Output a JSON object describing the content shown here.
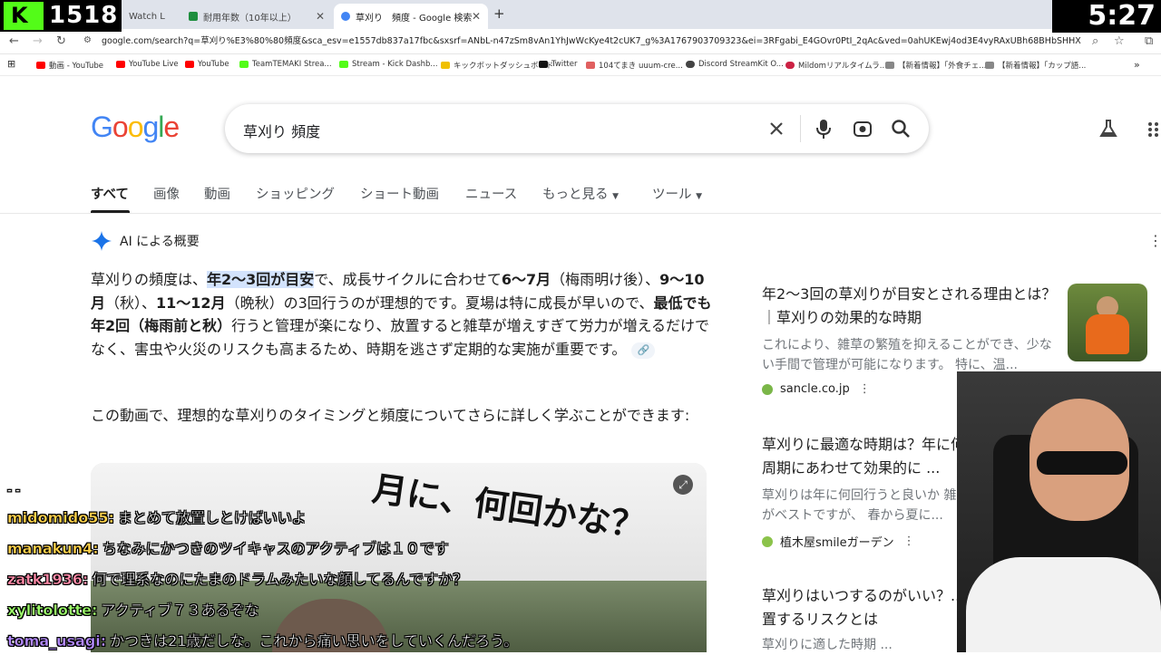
{
  "browser": {
    "tabs": [
      {
        "label": "Watch L",
        "active": false
      },
      {
        "label": "耐用年数（10年以上）",
        "active": false
      },
      {
        "label": "草刈り　頻度 - Google 検索",
        "active": true
      }
    ],
    "new_tab_label": "+",
    "url": "google.com/search?q=草刈り%E3%80%80頻度&sca_esv=e1557db837a17fbc&sxsrf=ANbL-n47zSm8vAn1YhJwWcKye4t2cUK7_g%3A1767903709323&ei=3RFgabi_E4GOvr0PtI_2qAc&ved=0ahUKEwj4od3E4vyRAxUBh68BHbSHHXUQ4dUDCBE&ua...",
    "bookmarks": [
      {
        "label": "動画 - YouTube",
        "color": "#ff0000"
      },
      {
        "label": "YouTube Live",
        "color": "#ff0000"
      },
      {
        "label": "YouTube",
        "color": "#ff0000"
      },
      {
        "label": "TeamTEMAKI Strea...",
        "color": "#53fc18"
      },
      {
        "label": "Stream - Kick Dashb...",
        "color": "#53fc18"
      },
      {
        "label": "キックボットダッシュボード",
        "color": "#f0c000"
      },
      {
        "label": "Twitter",
        "color": "#111111"
      },
      {
        "label": "104てまき uuum-cre...",
        "color": "#e06060"
      },
      {
        "label": "Discord StreamKit O...",
        "color": "#444444"
      },
      {
        "label": "Mildomリアルタイムラ...",
        "color": "#cc2244"
      },
      {
        "label": "【新着情報】「外食チェ...",
        "color": "#888888"
      },
      {
        "label": "【新着情報】「カップ語...",
        "color": "#888888"
      }
    ],
    "bookmarks_more": "»"
  },
  "stream": {
    "viewer_logo": "K",
    "viewer_count": "1518",
    "timer": "5:27"
  },
  "google": {
    "logo": "Google",
    "query": "草刈り 頻度",
    "tabs": [
      "すべて",
      "画像",
      "動画",
      "ショッピング",
      "ショート動画",
      "ニュース",
      "もっと見る",
      "ツール"
    ]
  },
  "ai_overview": {
    "heading": "AI による概要",
    "p1_a": "草刈りの頻度は、",
    "p1_b": "年2〜3回が目安",
    "p1_c": "で、成長サイクルに合わせて",
    "p1_d": "6〜7月",
    "p1_e": "（梅雨明け後）、",
    "p1_f": "9〜10月",
    "p1_g": "（秋）、",
    "p1_h": "11〜12月",
    "p1_i": "（晩秋）の3回行うのが理想的です。夏場は特に成長が早いので、",
    "p1_j": "最低でも年2回（梅雨前と秋）",
    "p1_k": "行うと管理が楽になり、放置すると雑草が増えすぎて労力が増えるだけでなく、害虫や火災のリスクも高まるため、時期を逃さず定期的な実施が重要です。",
    "p2": "この動画で、理想的な草刈りのタイミングと頻度についてさらに詳しく学ぶことができます:"
  },
  "video": {
    "caption": "月に、何回かな？"
  },
  "chat": [
    {
      "user": "-      -",
      "message": "",
      "color": "#ffffff"
    },
    {
      "user": "midomido55:",
      "message": "まとめて放置しとけばいいよ",
      "color": "#ffd24a"
    },
    {
      "user": "manakun4:",
      "message": "ちなみにかつきのツイキャスのアクティブは１０です",
      "color": "#ffd24a"
    },
    {
      "user": "zatk1936:",
      "message": "何で理系なのにたまのドラムみたいな顔してるんですか？",
      "color": "#ff8aa8"
    },
    {
      "user": "xylitolotte:",
      "message": "アクティブ７３あるぞな",
      "color": "#9dff6a"
    },
    {
      "user": "toma_usagi:",
      "message": "かつきは21歳だしな。これから痛い思いをしていくんだろう。",
      "color": "#b58bff"
    }
  ],
  "results": [
    {
      "title": "年2〜3回の草刈りが目安とされる理由とは？｜草刈りの効果的な時期",
      "snippet": "これにより、雑草の繁殖を抑えることができ、少ない手間で管理が可能になります。 特に、温...",
      "source": "sancle.co.jp"
    },
    {
      "title": "草刈りに最適な時期は？年に何回... 生長周期にあわせて効果的に ...",
      "snippet": "草刈りは年に何回行うと良いか 雑草の... 年3回がベストですが、 春から夏に...",
      "source": "植木屋smileガーデン"
    },
    {
      "title": "草刈りはいつするのがいい？... 雑草を放置するリスクとは",
      "snippet": "草刈りに適した時期 ...",
      "source": ""
    }
  ],
  "colors": {
    "accent_blue": "#1a73e8",
    "kick_green": "#53fc18"
  }
}
